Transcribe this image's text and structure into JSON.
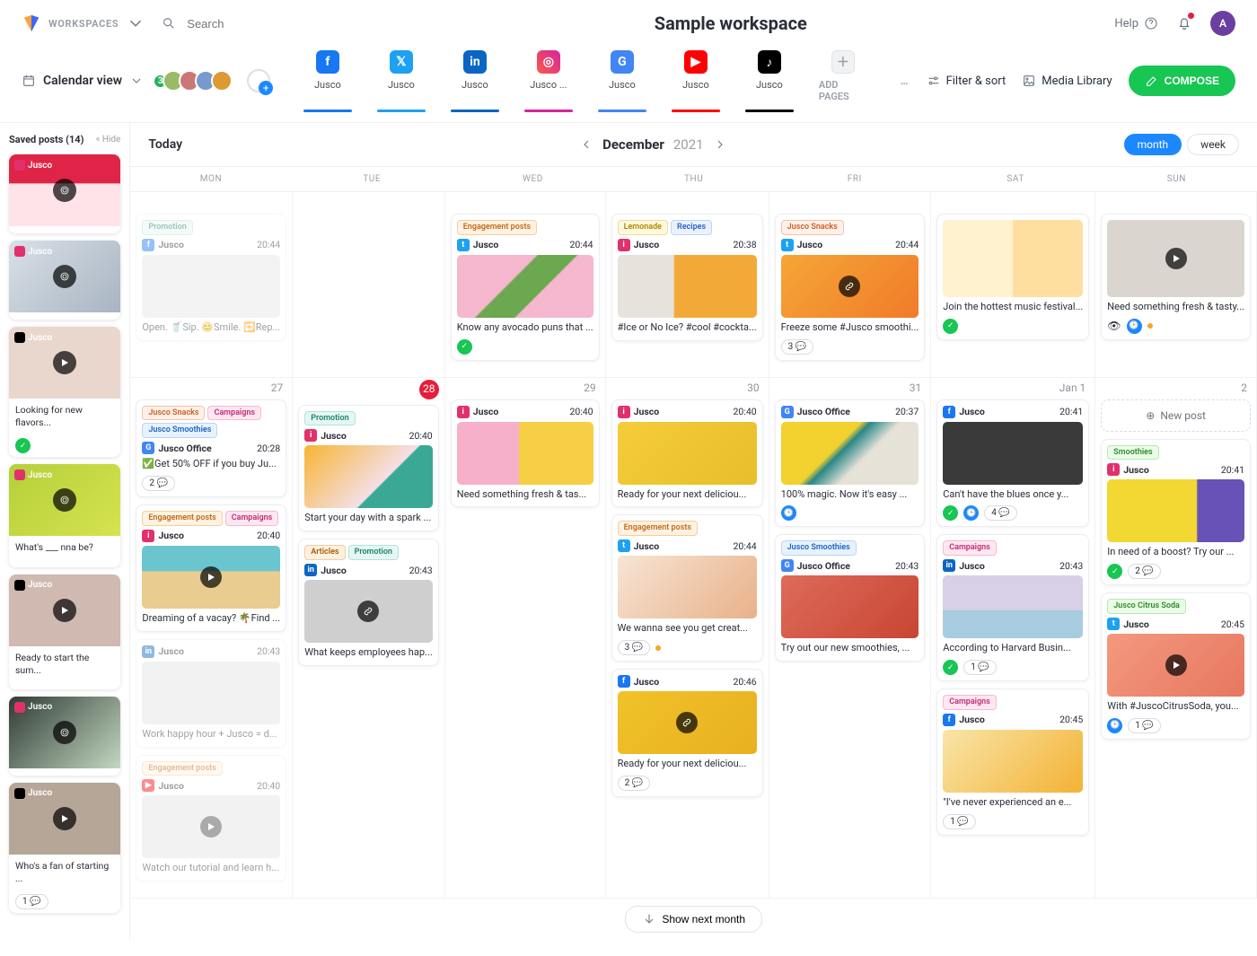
{
  "header": {
    "workspaces": "WORKSPACES",
    "search_ph": "Search",
    "title": "Sample workspace",
    "help": "Help",
    "avatar": "A"
  },
  "row2": {
    "calview": "Calendar view",
    "people_badge": "3",
    "ellipsis": "…",
    "filter": "Filter & sort",
    "media": "Media Library",
    "compose": "COMPOSE"
  },
  "tabs": [
    {
      "id": "fb",
      "label": "Jusco",
      "glyph": "f"
    },
    {
      "id": "tw",
      "label": "Jusco",
      "glyph": "𝕏"
    },
    {
      "id": "li",
      "label": "Jusco",
      "glyph": "in"
    },
    {
      "id": "ig",
      "label": "Jusco ...",
      "glyph": "◎"
    },
    {
      "id": "g",
      "label": "Jusco",
      "glyph": "G"
    },
    {
      "id": "yt",
      "label": "Jusco",
      "glyph": "▶"
    },
    {
      "id": "tk",
      "label": "Jusco",
      "glyph": "♪"
    }
  ],
  "add_pages": "ADD PAGES",
  "sidebar": {
    "title": "Saved posts (14)",
    "hide": "« Hide",
    "items": [
      {
        "net": "ig",
        "acc": "Jusco",
        "caption": "",
        "bg": "linear-gradient(180deg,#e02447 40%,#ffe3e8 41%)",
        "overlay": "target",
        "comments": ""
      },
      {
        "net": "ig",
        "acc": "Jusco",
        "caption": "",
        "bg": "linear-gradient(135deg,#d9e0e7,#a8b4c1)",
        "overlay": "target",
        "comments": ""
      },
      {
        "net": "tk",
        "acc": "Jusco",
        "caption": "Looking for new flavors...",
        "bg": "#e9d7ce",
        "overlay": "play",
        "badge": "ok"
      },
      {
        "net": "ig",
        "acc": "Jusco",
        "caption": "What's ___ nna be?",
        "bg": "linear-gradient(135deg,#b6cf3a,#d5e34f)",
        "overlay": "target",
        "comments": ""
      },
      {
        "net": "tk",
        "acc": "Jusco",
        "caption": "Ready to start the sum...",
        "bg": "#cfb9b1",
        "overlay": "play"
      },
      {
        "net": "ig",
        "acc": "Jusco",
        "caption": "",
        "bg": "linear-gradient(135deg,#2f3b34,#c3d7c1)",
        "overlay": "target"
      },
      {
        "net": "tk",
        "acc": "Jusco",
        "caption": "Who's a fan of starting ...",
        "bg": "#b6a698",
        "overlay": "play",
        "comments": "1"
      }
    ]
  },
  "caltop": {
    "today": "Today",
    "month": "December",
    "year": "2021",
    "btn_month": "month",
    "btn_week": "week"
  },
  "dow": [
    "MON",
    "TUE",
    "WED",
    "THU",
    "FRI",
    "SAT",
    "SUN"
  ],
  "actions": {
    "new_post": "New post",
    "show_next": "Show next month"
  },
  "rows": [
    [
      {
        "day": "",
        "cards": [
          {
            "faded": true,
            "tags": [
              {
                "p": "p-promo",
                "t": "Promotion"
              }
            ],
            "net": "fb",
            "acc": "Jusco",
            "time": "20:44",
            "thumb": "#e6e6e6",
            "txt": "Open. 🥤Sip. 😊Smile. 🔁Rep..."
          }
        ]
      },
      {
        "day": ""
      },
      {
        "day": "",
        "cards": [
          {
            "tags": [
              {
                "p": "p-eng",
                "t": "Engagement posts"
              }
            ],
            "net": "tw",
            "acc": "Jusco",
            "time": "20:44",
            "thumb": "linear-gradient(135deg,#f4b7ce 40%,#6ba84f 41%,#6ba84f 60%,#f4b7ce 61%)",
            "txt": "Know any avocado puns that ...",
            "foot": [
              "ok"
            ]
          }
        ]
      },
      {
        "day": "",
        "cards": [
          {
            "tags": [
              {
                "p": "p-lmn",
                "t": "Lemonade"
              },
              {
                "p": "p-rec",
                "t": "Recipes"
              }
            ],
            "net": "ig",
            "acc": "Jusco",
            "time": "20:38",
            "thumb": "linear-gradient(90deg,#e8e2dc 40%,#f3a938 41%)",
            "txt": "#Ice or No Ice? #cool #cockta..."
          }
        ]
      },
      {
        "day": "",
        "cards": [
          {
            "tags": [
              {
                "p": "p-snk",
                "t": "Jusco Snacks"
              }
            ],
            "net": "tw",
            "acc": "Jusco",
            "time": "20:44",
            "thumb": "linear-gradient(135deg,#f5a637,#f07b2a)",
            "thumb_link": true,
            "txt": "Freeze some #Jusco smoothi...",
            "foot": [
              "cmt:3"
            ]
          }
        ]
      },
      {
        "day": "",
        "cards": [
          {
            "thumb": "linear-gradient(90deg,#fff2ce 50%,#ffdfa0 50%)",
            "thumb_tall": true,
            "txt": "Join the hottest music festival...",
            "foot": [
              "ok"
            ]
          }
        ]
      },
      {
        "day": "",
        "cards": [
          {
            "thumb": "#dad6cf",
            "thumb_tall": true,
            "thumb_play": true,
            "txt": "Need something fresh & tasty...",
            "foot": [
              "eye",
              "clk",
              "dot"
            ]
          }
        ]
      }
    ],
    [
      {
        "day": "27",
        "cards": [
          {
            "tags": [
              {
                "p": "p-snk",
                "t": "Jusco Snacks"
              },
              {
                "p": "p-cmp",
                "t": "Campaigns"
              },
              {
                "p": "p-smo",
                "t": "Jusco Smoothies"
              }
            ],
            "net": "g",
            "acc": "Jusco Office",
            "time": "20:28",
            "txt": "✅Get 50% OFF if you buy Ju...",
            "foot": [
              "cmt:2"
            ]
          },
          {
            "tags": [
              {
                "p": "p-eng",
                "t": "Engagement posts"
              },
              {
                "p": "p-cmp",
                "t": "Campaigns"
              }
            ],
            "net": "ig",
            "acc": "Jusco",
            "time": "20:40",
            "thumb": "linear-gradient(180deg,#6bc5cf 40%,#e9cc8f 41%)",
            "thumb_play": true,
            "txt": "Dreaming of a vacay? 🌴Find ..."
          },
          {
            "faded": true,
            "net": "li",
            "acc": "Jusco",
            "time": "20:43",
            "thumb": "#e4e4e4",
            "txt": "Work happy hour + Jusco = d..."
          },
          {
            "faded": true,
            "tags": [
              {
                "p": "p-eng",
                "t": "Engagement posts"
              }
            ],
            "net": "yt",
            "acc": "Jusco",
            "time": "20:40",
            "thumb": "#e4e4e4",
            "thumb_play": true,
            "txt": "Watch our tutorial and learn h..."
          }
        ]
      },
      {
        "day": "28",
        "day_red": true,
        "cards": [
          {
            "tags": [
              {
                "p": "p-promo",
                "t": "Promotion"
              }
            ],
            "net": "ig",
            "acc": "Jusco",
            "time": "20:40",
            "thumb": "linear-gradient(135deg,#f8b431,#f3dfe6 60%,#3aa894 61%)",
            "txt": "Start your day with a spark ..."
          },
          {
            "tags": [
              {
                "p": "p-art",
                "t": "Articles"
              },
              {
                "p": "p-promo",
                "t": "Promotion"
              }
            ],
            "net": "li",
            "acc": "Jusco",
            "time": "20:43",
            "thumb": "#cfcfcf",
            "thumb_link": true,
            "txt": "What keeps employees hap..."
          }
        ]
      },
      {
        "day": "29",
        "cards": [
          {
            "net": "ig",
            "acc": "Jusco",
            "time": "20:40",
            "thumb": "linear-gradient(90deg,#f7b0ca 45%,#f7cf46 46%)",
            "txt": "Need something fresh & tas..."
          }
        ]
      },
      {
        "day": "30",
        "cards": [
          {
            "net": "ig",
            "acc": "Jusco",
            "time": "20:40",
            "thumb": "linear-gradient(135deg,#f5cc3a,#e7be2b)",
            "txt": "Ready for your next deliciou..."
          },
          {
            "tags": [
              {
                "p": "p-eng",
                "t": "Engagement posts"
              }
            ],
            "net": "tw",
            "acc": "Jusco",
            "time": "20:44",
            "thumb": "linear-gradient(135deg,#f6e5d5,#e8b188)",
            "txt": "We wanna see you get creat...",
            "foot": [
              "cmt:3",
              "dot"
            ]
          },
          {
            "net": "fb",
            "acc": "Jusco",
            "time": "20:46",
            "thumb": "linear-gradient(135deg,#f0c229,#e9b020)",
            "thumb_link": true,
            "txt": "Ready for your next deliciou...",
            "foot": [
              "cmt:2"
            ]
          }
        ]
      },
      {
        "day": "31",
        "cards": [
          {
            "net": "g",
            "acc": "Jusco Office",
            "time": "20:37",
            "thumb": "linear-gradient(135deg,#f3d12f 40%,#2b8787 45%,#e7e2d7 60%)",
            "txt": "100% magic. Now it's easy ...",
            "foot": [
              "clk"
            ]
          },
          {
            "tags": [
              {
                "p": "p-smo",
                "t": "Jusco Smoothies"
              }
            ],
            "net": "g",
            "acc": "Jusco Office",
            "time": "20:43",
            "thumb": "linear-gradient(135deg,#dd6b5a,#c94533)",
            "txt": "Try out our new smoothies, ..."
          }
        ]
      },
      {
        "day": "Jan 1",
        "cards": [
          {
            "net": "fb",
            "acc": "Jusco",
            "time": "20:41",
            "thumb": "#3a3a3a",
            "txt": "Can't have the blues once y...",
            "foot": [
              "ok",
              "clk",
              "cmt:4"
            ]
          },
          {
            "tags": [
              {
                "p": "p-cmp",
                "t": "Campaigns"
              }
            ],
            "net": "li",
            "acc": "Jusco",
            "time": "20:43",
            "thumb": "linear-gradient(180deg,#d8d0e6 55%,#a7cce0 56%)",
            "txt": "According to Harvard Busin...",
            "foot": [
              "ok",
              "cmt:1"
            ]
          },
          {
            "tags": [
              {
                "p": "p-cmp",
                "t": "Campaigns"
              }
            ],
            "net": "fb",
            "acc": "Jusco",
            "time": "20:45",
            "thumb": "linear-gradient(135deg,#f8e5a8,#f3b234)",
            "txt": "\"I've never experienced an e...",
            "foot": [
              "cmt:1"
            ]
          }
        ]
      },
      {
        "day": "2",
        "new_post": true,
        "cards": [
          {
            "tags": [
              {
                "p": "p-smooth",
                "t": "Smoothies"
              }
            ],
            "net": "ig",
            "acc": "Jusco",
            "time": "20:41",
            "thumb": "linear-gradient(90deg,#f3d733 65%,#6851b7 66%)",
            "txt": "In need of a boost? Try our ...",
            "foot": [
              "ok",
              "cmt:2"
            ]
          },
          {
            "tags": [
              {
                "p": "p-citrus",
                "t": "Jusco Citrus Soda"
              }
            ],
            "net": "tw",
            "acc": "Jusco",
            "time": "20:45",
            "thumb": "linear-gradient(135deg,#f3997f,#e77760)",
            "thumb_play": true,
            "txt": "With #JuscoCitrusSoda, you...",
            "foot": [
              "clk",
              "cmt:1"
            ]
          }
        ]
      }
    ]
  ]
}
